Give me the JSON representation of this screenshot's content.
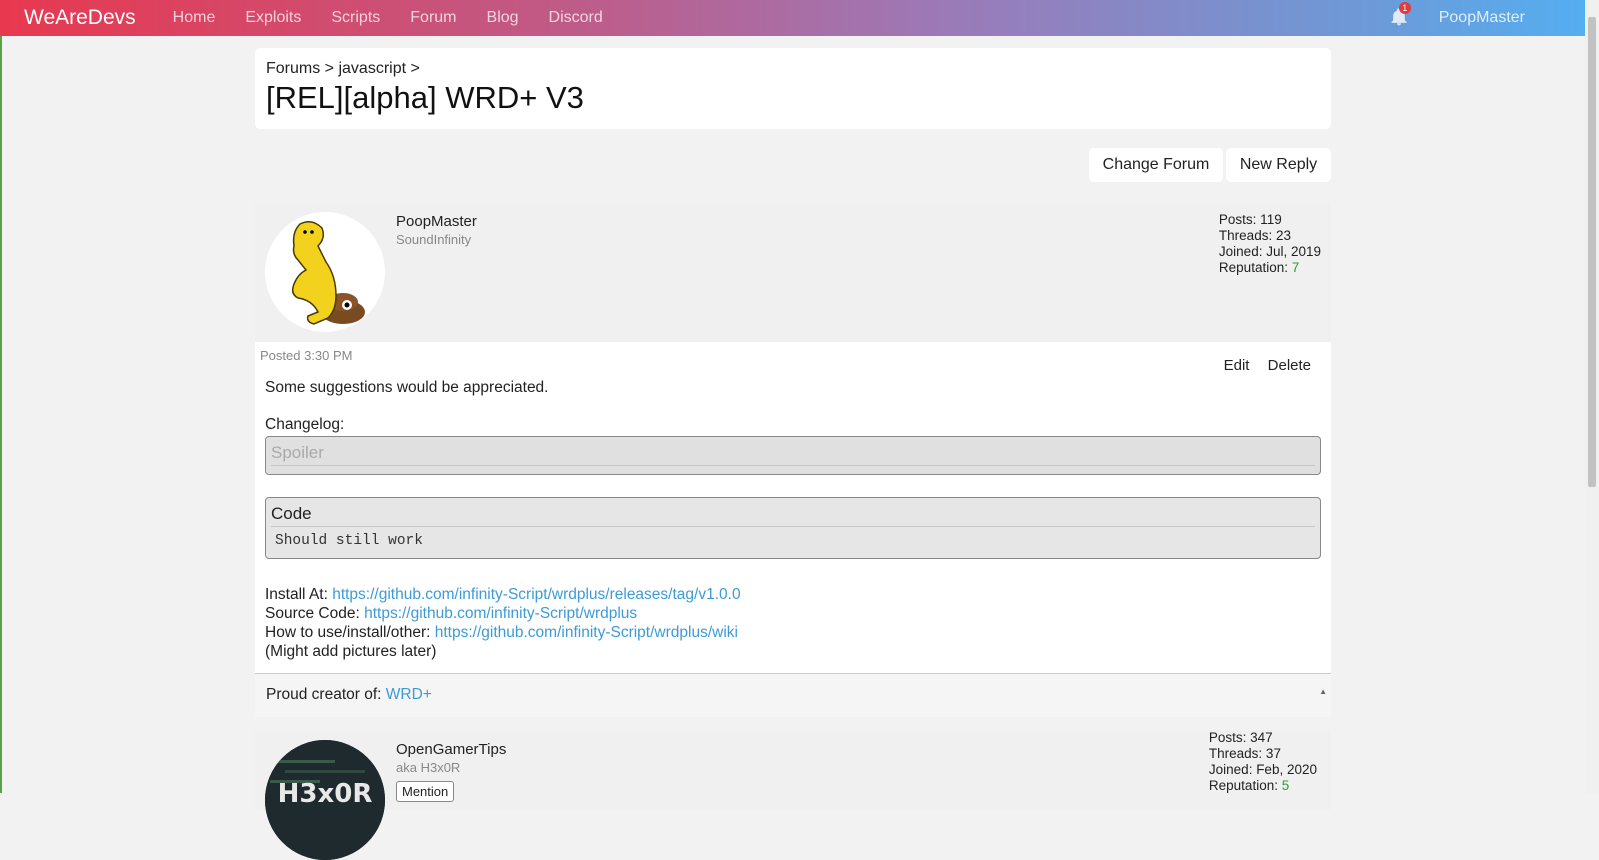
{
  "nav": {
    "brand": "WeAreDevs",
    "links": [
      "Home",
      "Exploits",
      "Scripts",
      "Forum",
      "Blog",
      "Discord"
    ],
    "notification_count": "1",
    "username": "PoopMaster"
  },
  "header": {
    "breadcrumb": "Forums > javascript >",
    "title": "[REL][alpha] WRD+ V3"
  },
  "buttons": {
    "change_forum": "Change Forum",
    "new_reply": "New Reply"
  },
  "post1": {
    "author": "PoopMaster",
    "subtitle": "SoundInfinity",
    "stats": {
      "posts": "Posts: 119",
      "threads": "Threads: 23",
      "joined": "Joined: Jul, 2019",
      "rep_label": "Reputation: ",
      "rep_value": "7"
    },
    "posted": "Posted 3:30 PM",
    "edit": "Edit",
    "delete": "Delete",
    "message": "Some suggestions would be appreciated.",
    "changelog": "Changelog:",
    "spoiler": "Spoiler",
    "code_title": "Code",
    "code_text": "Should still work",
    "install_label": "Install At: ",
    "install_url": "https://github.com/infinity-Script/wrdplus/releases/tag/v1.0.0",
    "source_label": "Source Code: ",
    "source_url": "https://github.com/infinity-Script/wrdplus",
    "howto_label": "How to use/install/other: ",
    "howto_url": "https://github.com/infinity-Script/wrdplus/wiki",
    "note": "(Might add pictures later)",
    "signature_label": "Proud creator of: ",
    "signature_link": "WRD+"
  },
  "post2": {
    "author": "OpenGamerTips",
    "subtitle": "aka H3x0R",
    "mention": "Mention",
    "avatar_text": "H3x0R",
    "stats": {
      "posts": "Posts: 347",
      "threads": "Threads: 37",
      "joined": "Joined: Feb, 2020",
      "rep_label": "Reputation: ",
      "rep_value": "5"
    }
  },
  "colors": {
    "accent": "#3c9bd6",
    "reputation": "#2aa12a",
    "nav_gradient_start": "#e8384f",
    "nav_gradient_end": "#54aef0"
  }
}
